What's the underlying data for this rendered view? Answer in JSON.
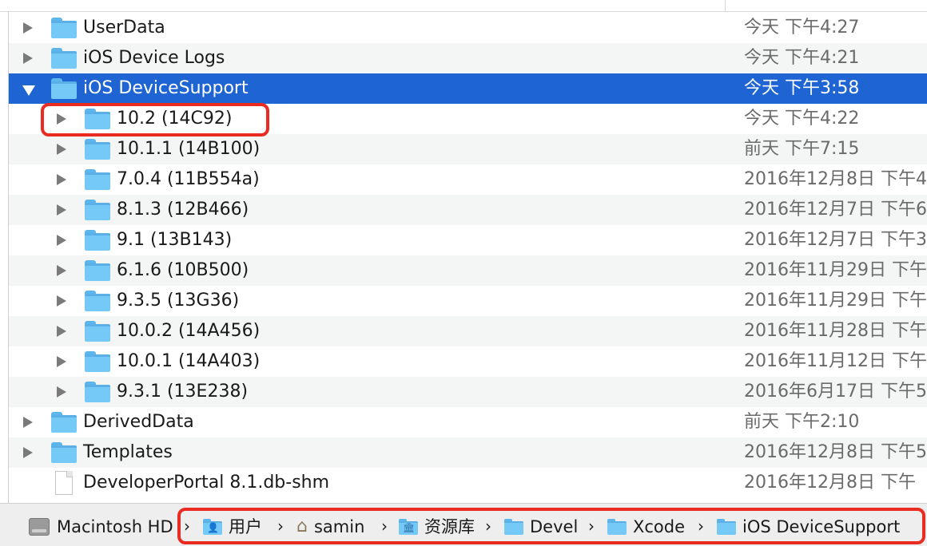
{
  "rows": [
    {
      "name": "UserData",
      "date": "今天 下午4:27",
      "kind": "folder",
      "level": 0,
      "disclosure": "closed"
    },
    {
      "name": "iOS Device Logs",
      "date": "今天 下午4:21",
      "kind": "folder",
      "level": 0,
      "disclosure": "closed"
    },
    {
      "name": "iOS DeviceSupport",
      "date": "今天 下午3:58",
      "kind": "folder",
      "level": 0,
      "disclosure": "open",
      "selected": true
    },
    {
      "name": "10.2 (14C92)",
      "date": "今天 下午4:22",
      "kind": "folder",
      "level": 1,
      "disclosure": "closed"
    },
    {
      "name": "10.1.1 (14B100)",
      "date": "前天 下午7:15",
      "kind": "folder",
      "level": 1,
      "disclosure": "closed"
    },
    {
      "name": "7.0.4 (11B554a)",
      "date": "2016年12月8日 下午4",
      "kind": "folder",
      "level": 1,
      "disclosure": "closed"
    },
    {
      "name": "8.1.3 (12B466)",
      "date": "2016年12月7日 下午6",
      "kind": "folder",
      "level": 1,
      "disclosure": "closed"
    },
    {
      "name": "9.1 (13B143)",
      "date": "2016年12月7日 下午3",
      "kind": "folder",
      "level": 1,
      "disclosure": "closed"
    },
    {
      "name": "6.1.6 (10B500)",
      "date": "2016年11月29日 下午",
      "kind": "folder",
      "level": 1,
      "disclosure": "closed"
    },
    {
      "name": "9.3.5 (13G36)",
      "date": "2016年11月29日 下午",
      "kind": "folder",
      "level": 1,
      "disclosure": "closed"
    },
    {
      "name": "10.0.2 (14A456)",
      "date": "2016年11月28日 下午",
      "kind": "folder",
      "level": 1,
      "disclosure": "closed"
    },
    {
      "name": "10.0.1 (14A403)",
      "date": "2016年11月12日 下午",
      "kind": "folder",
      "level": 1,
      "disclosure": "closed"
    },
    {
      "name": "9.3.1 (13E238)",
      "date": "2016年6月17日 下午5",
      "kind": "folder",
      "level": 1,
      "disclosure": "closed"
    },
    {
      "name": "DerivedData",
      "date": "前天 下午2:10",
      "kind": "folder",
      "level": 0,
      "disclosure": "closed"
    },
    {
      "name": "Templates",
      "date": "2016年12月8日 下午5",
      "kind": "folder",
      "level": 0,
      "disclosure": "closed"
    },
    {
      "name": "DeveloperPortal 8.1.db-shm",
      "date": "2016年12月8日 下午",
      "kind": "file",
      "level": 0,
      "disclosure": "none"
    }
  ],
  "path_bar": [
    {
      "label": "Macintosh HD",
      "icon": "hard-drive-icon"
    },
    {
      "label": "用户",
      "icon": "users-folder-icon"
    },
    {
      "label": "samin",
      "icon": "home-icon"
    },
    {
      "label": "资源库",
      "icon": "library-folder-icon"
    },
    {
      "label": "Devel",
      "icon": "folder-icon"
    },
    {
      "label": "Xcode",
      "icon": "folder-icon"
    },
    {
      "label": "iOS DeviceSupport",
      "icon": "folder-icon"
    }
  ],
  "colors": {
    "selection": "#1e65d3",
    "annotation": "#ea2b21",
    "folder": "#75c9f6"
  }
}
